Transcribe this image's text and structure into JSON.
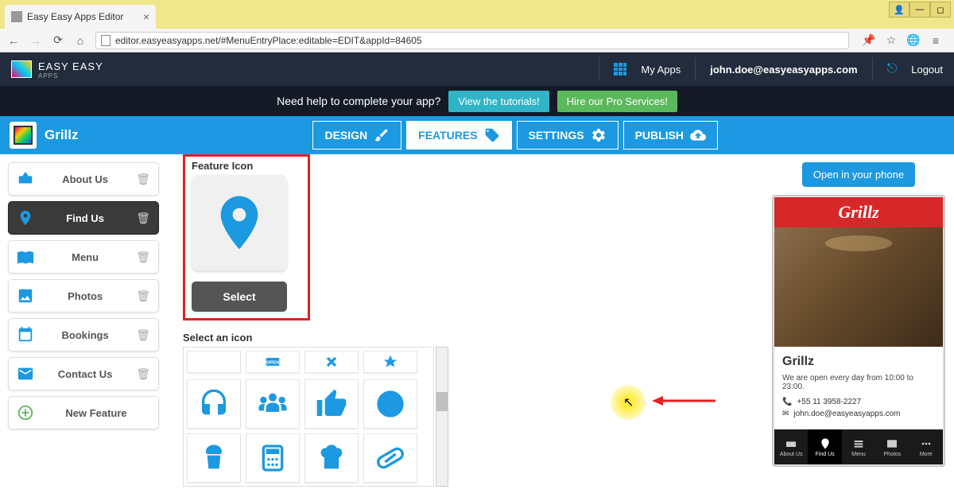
{
  "browser": {
    "tab_title": "Easy Easy Apps Editor",
    "url": "editor.easyeasyapps.net/#MenuEntryPlace:editable=EDIT&appId=84605"
  },
  "header": {
    "logo_text": "EASY EASY",
    "logo_sub": "APPS",
    "my_apps": "My Apps",
    "user_email": "john.doe@easyeasyapps.com",
    "logout": "Logout"
  },
  "help_bar": {
    "text": "Need help to complete your app?",
    "tutorials_btn": "View the tutorials!",
    "pro_btn": "Hire our Pro Services!"
  },
  "app_bar": {
    "app_name": "Grillz",
    "tabs": {
      "design": "DESIGN",
      "features": "FEATURES",
      "settings": "SETTINGS",
      "publish": "PUBLISH"
    }
  },
  "sidebar": {
    "items": [
      {
        "label": "About Us"
      },
      {
        "label": "Find Us"
      },
      {
        "label": "Menu"
      },
      {
        "label": "Photos"
      },
      {
        "label": "Bookings"
      },
      {
        "label": "Contact Us"
      }
    ],
    "new_feature": "New Feature"
  },
  "content": {
    "feature_icon_label": "Feature Icon",
    "select_btn": "Select",
    "select_icon_label": "Select an icon"
  },
  "preview": {
    "open_btn": "Open in your phone",
    "brand": "Grillz",
    "title": "Grillz",
    "hours": "We are open every day from 10:00 to 23:00.",
    "phone": "+55 11 3958-2227",
    "email": "john.doe@easyeasyapps.com",
    "nav": [
      "About Us",
      "Find Us",
      "Menu",
      "Photos",
      "More"
    ]
  }
}
